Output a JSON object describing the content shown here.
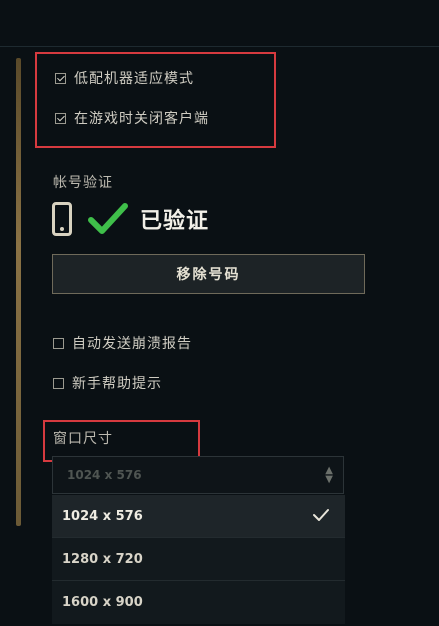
{
  "options": {
    "low_spec_mode": {
      "label": "低配机器适应模式",
      "checked": true
    },
    "close_client_in_game": {
      "label": "在游戏时关闭客户端",
      "checked": true
    }
  },
  "account": {
    "section_title": "帐号验证",
    "status": "已验证",
    "remove_button": "移除号码"
  },
  "misc": {
    "auto_crash_report": {
      "label": "自动发送崩溃报告",
      "checked": false
    },
    "beginner_tips": {
      "label": "新手帮助提示",
      "checked": false
    }
  },
  "window_size": {
    "section_title": "窗口尺寸",
    "current": "1024 x 576",
    "options": [
      "1024 x 576",
      "1280 x 720",
      "1600 x 900"
    ],
    "selected_index": 0
  },
  "colors": {
    "accent_green": "#3fbf4a",
    "highlight_red": "#d63a3f",
    "gold": "#8a7245"
  }
}
